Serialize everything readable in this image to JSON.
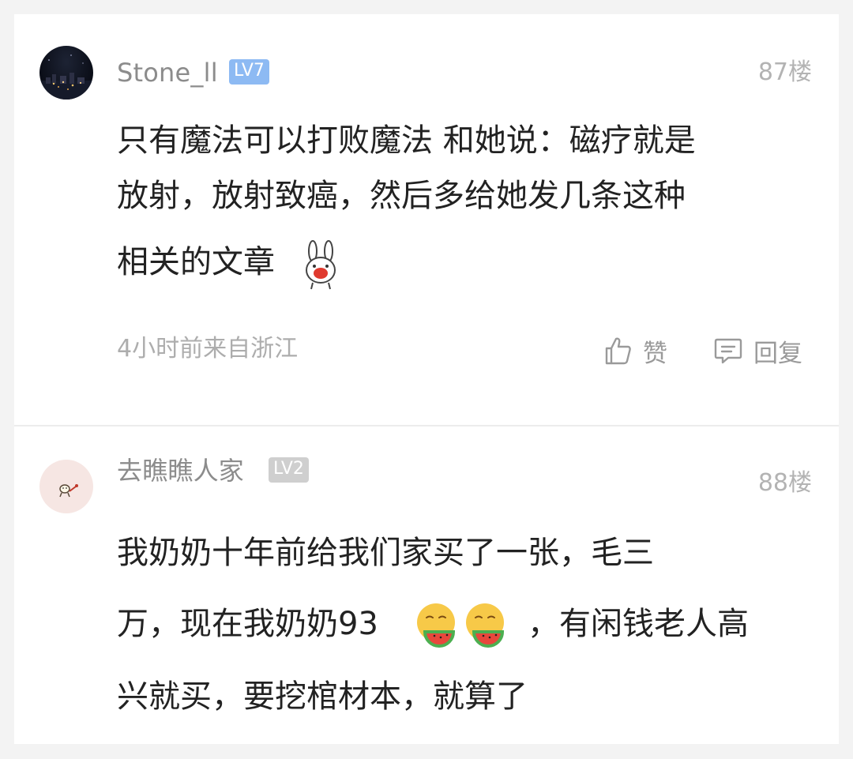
{
  "comments": [
    {
      "username": "Stone_ll",
      "level": "LV7",
      "floor": "87楼",
      "lines": [
        "只有魔法可以打败魔法  和她说：磁疗就是",
        "放射，放射致癌，然后多给她发几条这种",
        "相关的文章"
      ],
      "inline_emoji": "bunny-emoji",
      "time_location": "4小时前来自浙江",
      "like_label": "赞",
      "reply_label": "回复"
    },
    {
      "username": "去瞧瞧人家",
      "level": "LV2",
      "floor": "88楼",
      "lines": [
        "我奶奶十年前给我们家买了一张，毛三",
        "万，现在我奶奶93",
        "，有闲钱老人高",
        "兴就买，要挖棺材本，就算了"
      ],
      "inline_emoji": "watermelon-emoji"
    }
  ],
  "colors": {
    "background": "#f3f3f3",
    "card": "#ffffff",
    "lv7_badge": "#8dbaf3",
    "lv2_badge": "#cfcfcf",
    "text": "#222222",
    "muted": "#adadad"
  },
  "icons": [
    "thumbs-up-icon",
    "comment-icon"
  ]
}
